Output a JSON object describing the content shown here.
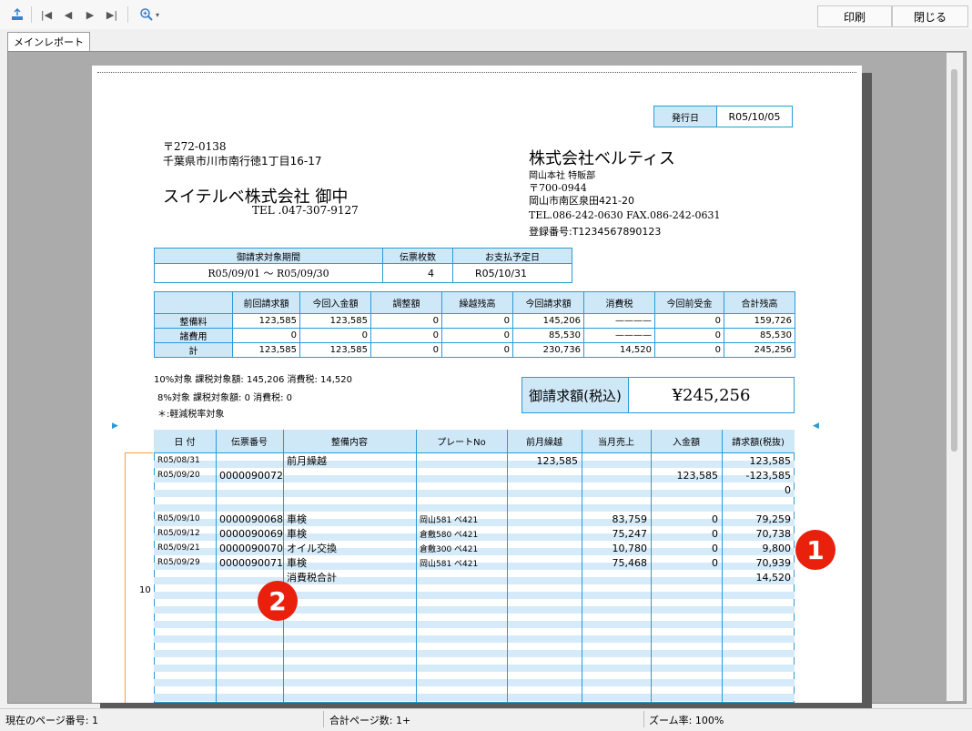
{
  "toolbar": {
    "print_label": "印刷",
    "close_label": "閉じる"
  },
  "tab": {
    "label": "メインレポート"
  },
  "invoice": {
    "issue_label": "発行日",
    "issue_date": "R05/10/05",
    "postal": "〒272-0138",
    "address": "千葉県市川市南行徳1丁目16-17",
    "recipient": "スイテルベ株式会社 御中",
    "recipient_tel": "TEL .047-307-9127",
    "company": "株式会社ベルティス",
    "dept": "岡山本社 特販部",
    "company_postal": "〒700-0944",
    "company_address": "岡山市南区泉田421-20",
    "company_tel": "TEL.086-242-0630 FAX.086-242-0631",
    "reg_no": "登録番号:T1234567890123",
    "period_header": "御請求対象期間",
    "count_header": "伝票枚数",
    "due_header": "お支払予定日",
    "period_value": "R05/09/01 〜 R05/09/30",
    "count_value": "4",
    "due_value": "R05/10/31",
    "summary_headers": [
      "前回請求額",
      "今回入金額",
      "調整額",
      "繰越残高",
      "今回請求額",
      "消費税",
      "今回前受金",
      "合計残高"
    ],
    "summary_rows": [
      {
        "label": "整備料",
        "values": [
          "123,585",
          "123,585",
          "0",
          "0",
          "145,206",
          "————",
          "0",
          "159,726"
        ]
      },
      {
        "label": "諸費用",
        "values": [
          "0",
          "0",
          "0",
          "0",
          "85,530",
          "————",
          "0",
          "85,530"
        ]
      },
      {
        "label": "計",
        "values": [
          "123,585",
          "123,585",
          "0",
          "0",
          "230,736",
          "14,520",
          "0",
          "245,256"
        ]
      }
    ],
    "tax_line1": "10%対象 課税対象額: 145,206 消費税: 14,520",
    "tax_line2": "8%対象 課税対象額: 0 消費税: 0",
    "tax_line3": "＊:軽減税率対象",
    "total_label": "御請求額(税込)",
    "total_value": "¥245,256",
    "detail_headers": [
      "日 付",
      "伝票番号",
      "整備内容",
      "プレートNo",
      "前月繰越",
      "当月売上",
      "入金額",
      "請求額(税抜)"
    ],
    "detail_rows": [
      [
        "R05/08/31",
        "",
        "前月繰越",
        "",
        "123,585",
        "",
        "",
        "123,585"
      ],
      [
        "R05/09/20",
        "0000090072",
        "",
        "",
        "",
        "",
        "123,585",
        "-123,585"
      ],
      [
        "",
        "",
        "",
        "",
        "",
        "",
        "",
        "0"
      ],
      [
        "",
        "",
        "",
        "",
        "",
        "",
        "",
        ""
      ],
      [
        "R05/09/10",
        "0000090068",
        "車検",
        "岡山581 ペ421",
        "",
        "83,759",
        "0",
        "79,259"
      ],
      [
        "R05/09/12",
        "0000090069",
        "車検",
        "倉敷580 ペ421",
        "",
        "75,247",
        "0",
        "70,738"
      ],
      [
        "R05/09/21",
        "0000090070",
        "オイル交換",
        "倉敷300 ペ421",
        "",
        "10,780",
        "0",
        "9,800"
      ],
      [
        "R05/09/29",
        "0000090071",
        "車検",
        "岡山581 ペ421",
        "",
        "75,468",
        "0",
        "70,939"
      ],
      [
        "",
        "",
        "消費税合計",
        "",
        "",
        "",
        "",
        "14,520"
      ]
    ],
    "row_marker": "10"
  },
  "callouts": {
    "one": "1",
    "two": "2"
  },
  "status": {
    "page": "現在のページ番号: 1",
    "total": "合計ページ数: 1+",
    "zoom": "ズーム率: 100%"
  }
}
